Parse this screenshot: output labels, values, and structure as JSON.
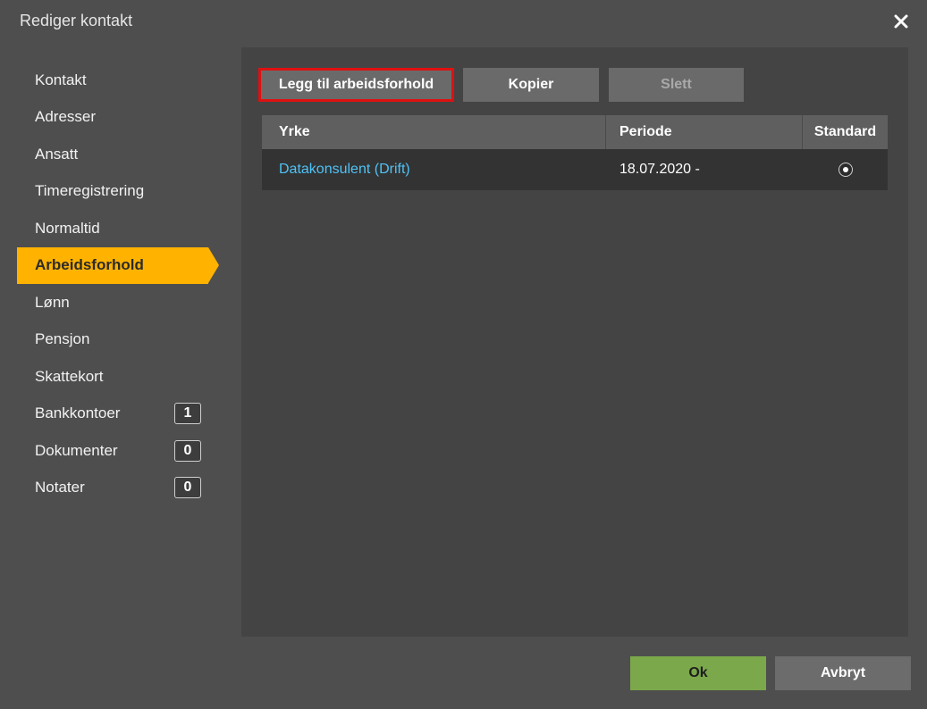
{
  "dialog": {
    "title": "Rediger kontakt",
    "close_icon": "close-icon"
  },
  "sidebar": {
    "items": [
      {
        "label": "Kontakt"
      },
      {
        "label": "Adresser"
      },
      {
        "label": "Ansatt"
      },
      {
        "label": "Timeregistrering"
      },
      {
        "label": "Normaltid"
      },
      {
        "label": "Arbeidsforhold",
        "active": true
      },
      {
        "label": "Lønn"
      },
      {
        "label": "Pensjon"
      },
      {
        "label": "Skattekort"
      },
      {
        "label": "Bankkontoer",
        "count": "1"
      },
      {
        "label": "Dokumenter",
        "count": "0"
      },
      {
        "label": "Notater",
        "count": "0"
      }
    ]
  },
  "toolbar": {
    "add_label": "Legg til arbeidsforhold",
    "copy_label": "Kopier",
    "delete_label": "Slett"
  },
  "table": {
    "headers": {
      "yrke": "Yrke",
      "periode": "Periode",
      "standard": "Standard"
    },
    "rows": [
      {
        "yrke": "Datakonsulent (Drift)",
        "periode": "18.07.2020 -",
        "standard": true
      }
    ]
  },
  "footer": {
    "ok_label": "Ok",
    "cancel_label": "Avbryt"
  },
  "colors": {
    "accent": "#ffb300",
    "ok": "#7ba84a",
    "link": "#4fc3f7",
    "highlight_border": "#e01010"
  }
}
